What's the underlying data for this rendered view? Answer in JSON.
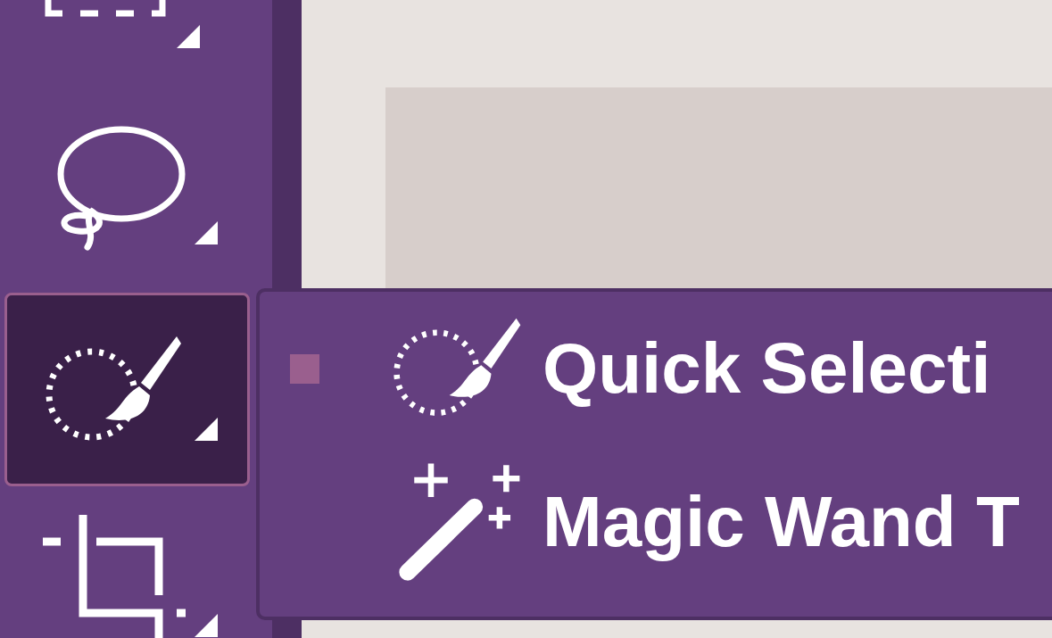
{
  "toolbar": {
    "tools": [
      {
        "kind": "marquee",
        "selected": false
      },
      {
        "kind": "lasso",
        "selected": false
      },
      {
        "kind": "quick-selection",
        "selected": true
      },
      {
        "kind": "crop",
        "selected": false
      }
    ]
  },
  "flyout": {
    "items": [
      {
        "kind": "quick-selection",
        "label": "Quick Selecti",
        "selected": true
      },
      {
        "kind": "magic-wand",
        "label": "Magic Wand T",
        "selected": false
      }
    ]
  }
}
